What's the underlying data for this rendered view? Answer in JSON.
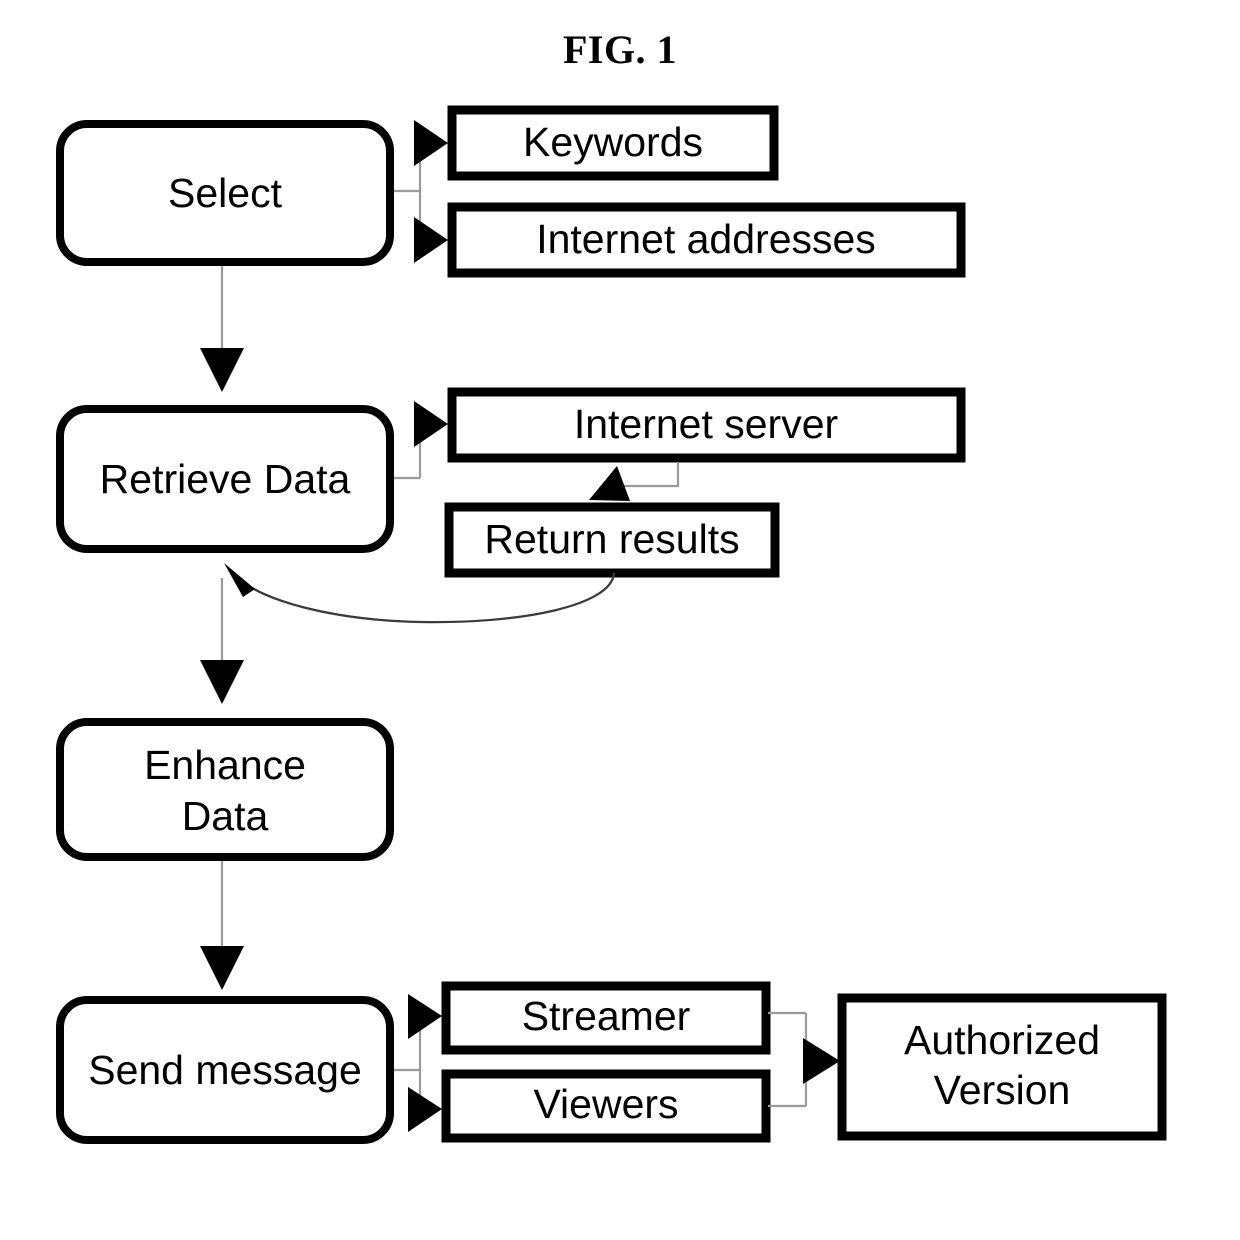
{
  "figure": {
    "title": "FIG. 1",
    "type": "patent-flowchart",
    "background_color": "#ffffff",
    "line_color": "#000000"
  },
  "nodes": {
    "select": {
      "label": "Select",
      "shape": "rounded-rect"
    },
    "keywords": {
      "label": "Keywords",
      "shape": "rect"
    },
    "internet_addresses": {
      "label": "Internet addresses",
      "shape": "rect"
    },
    "retrieve_data": {
      "label": "Retrieve Data",
      "shape": "rounded-rect"
    },
    "internet_server": {
      "label": "Internet server",
      "shape": "rect"
    },
    "return_results": {
      "label": "Return results",
      "shape": "rect"
    },
    "enhance_data": {
      "label_line1": "Enhance",
      "label_line2": "Data",
      "shape": "rounded-rect"
    },
    "send_message": {
      "label": "Send message",
      "shape": "rounded-rect"
    },
    "streamer": {
      "label": "Streamer",
      "shape": "rect"
    },
    "viewers": {
      "label": "Viewers",
      "shape": "rect"
    },
    "authorized_version": {
      "label_line1": "Authorized",
      "label_line2": "Version",
      "shape": "rect"
    }
  },
  "edges": [
    {
      "from": "select",
      "to": "keywords",
      "style": "branch-arrow"
    },
    {
      "from": "select",
      "to": "internet_addresses",
      "style": "branch-arrow"
    },
    {
      "from": "select",
      "to": "retrieve_data",
      "style": "vertical-arrow"
    },
    {
      "from": "retrieve_data",
      "to": "internet_server",
      "style": "branch-arrow"
    },
    {
      "from": "internet_server",
      "to": "return_results",
      "style": "elbow-arrow"
    },
    {
      "from": "return_results",
      "to": "retrieve_data",
      "style": "curved-feedback-arrow"
    },
    {
      "from": "retrieve_data",
      "to": "enhance_data",
      "style": "vertical-arrow"
    },
    {
      "from": "enhance_data",
      "to": "send_message",
      "style": "vertical-arrow"
    },
    {
      "from": "send_message",
      "to": "streamer",
      "style": "branch-arrow"
    },
    {
      "from": "send_message",
      "to": "viewers",
      "style": "branch-arrow"
    },
    {
      "from": "streamer",
      "to": "authorized_version",
      "style": "merge-arrow"
    },
    {
      "from": "viewers",
      "to": "authorized_version",
      "style": "merge-arrow"
    }
  ]
}
